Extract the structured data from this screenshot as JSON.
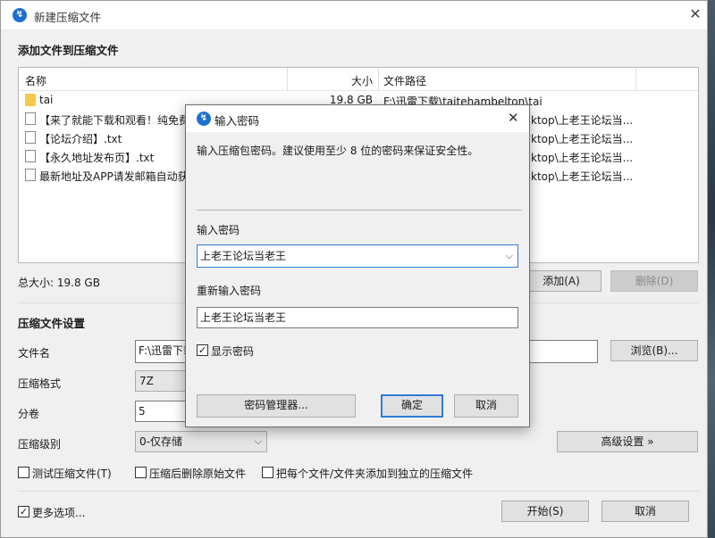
{
  "window": {
    "title": "新建压缩文件",
    "section_add": "添加文件到压缩文件",
    "columns": {
      "name": "名称",
      "size": "大小",
      "path": "文件路径"
    },
    "files": [
      {
        "name": "tai",
        "size": "19.8 GB",
        "path": "F:\\迅雷下载\\taitehambelton\\tai",
        "type": "folder"
      },
      {
        "name": "【来了就能下载和观看！纯免费",
        "size": "",
        "path": "ktop\\上老王论坛当...",
        "type": "doc"
      },
      {
        "name": "【论坛介绍】.txt",
        "size": "",
        "path": "ktop\\上老王论坛当...",
        "type": "doc"
      },
      {
        "name": "【永久地址发布页】.txt",
        "size": "",
        "path": "ktop\\上老王论坛当...",
        "type": "doc"
      },
      {
        "name": "最新地址及APP请发邮箱自动获",
        "size": "",
        "path": "ktop\\上老王论坛当...",
        "type": "doc"
      }
    ],
    "total_size": "总大小: 19.8 GB",
    "add_button": "添加(A)",
    "delete_button": "删除(D)",
    "section_settings": "压缩文件设置",
    "filename_label": "文件名",
    "filename_value": "F:\\迅雷下载",
    "browse_button": "浏览(B)...",
    "format_label": "压缩格式",
    "format_value": "7Z",
    "volume_label": "分卷",
    "volume_value": "5",
    "level_label": "压缩级别",
    "level_value": "0-仅存储",
    "advanced_button": "高级设置 »",
    "opt_test": "测试压缩文件(T)",
    "opt_delete_src": "压缩后删除原始文件",
    "opt_each": "把每个文件/文件夹添加到独立的压缩文件",
    "more_options": "更多选项...",
    "start_button": "开始(S)",
    "cancel_button": "取消"
  },
  "dialog": {
    "title": "输入密码",
    "hint": "输入压缩包密码。建议使用至少 8 位的密码来保证安全性。",
    "password_label": "输入密码",
    "password_value": "上老王论坛当老王",
    "reenter_label": "重新输入密码",
    "reenter_value": "上老王论坛当老王",
    "show_password": "显示密码",
    "manager_button": "密码管理器...",
    "ok_button": "确定",
    "cancel_button": "取消"
  },
  "colors": {
    "accent": "#2f7bd6",
    "app_icon": "#1e6fd0",
    "folder": "#f2c94c"
  }
}
